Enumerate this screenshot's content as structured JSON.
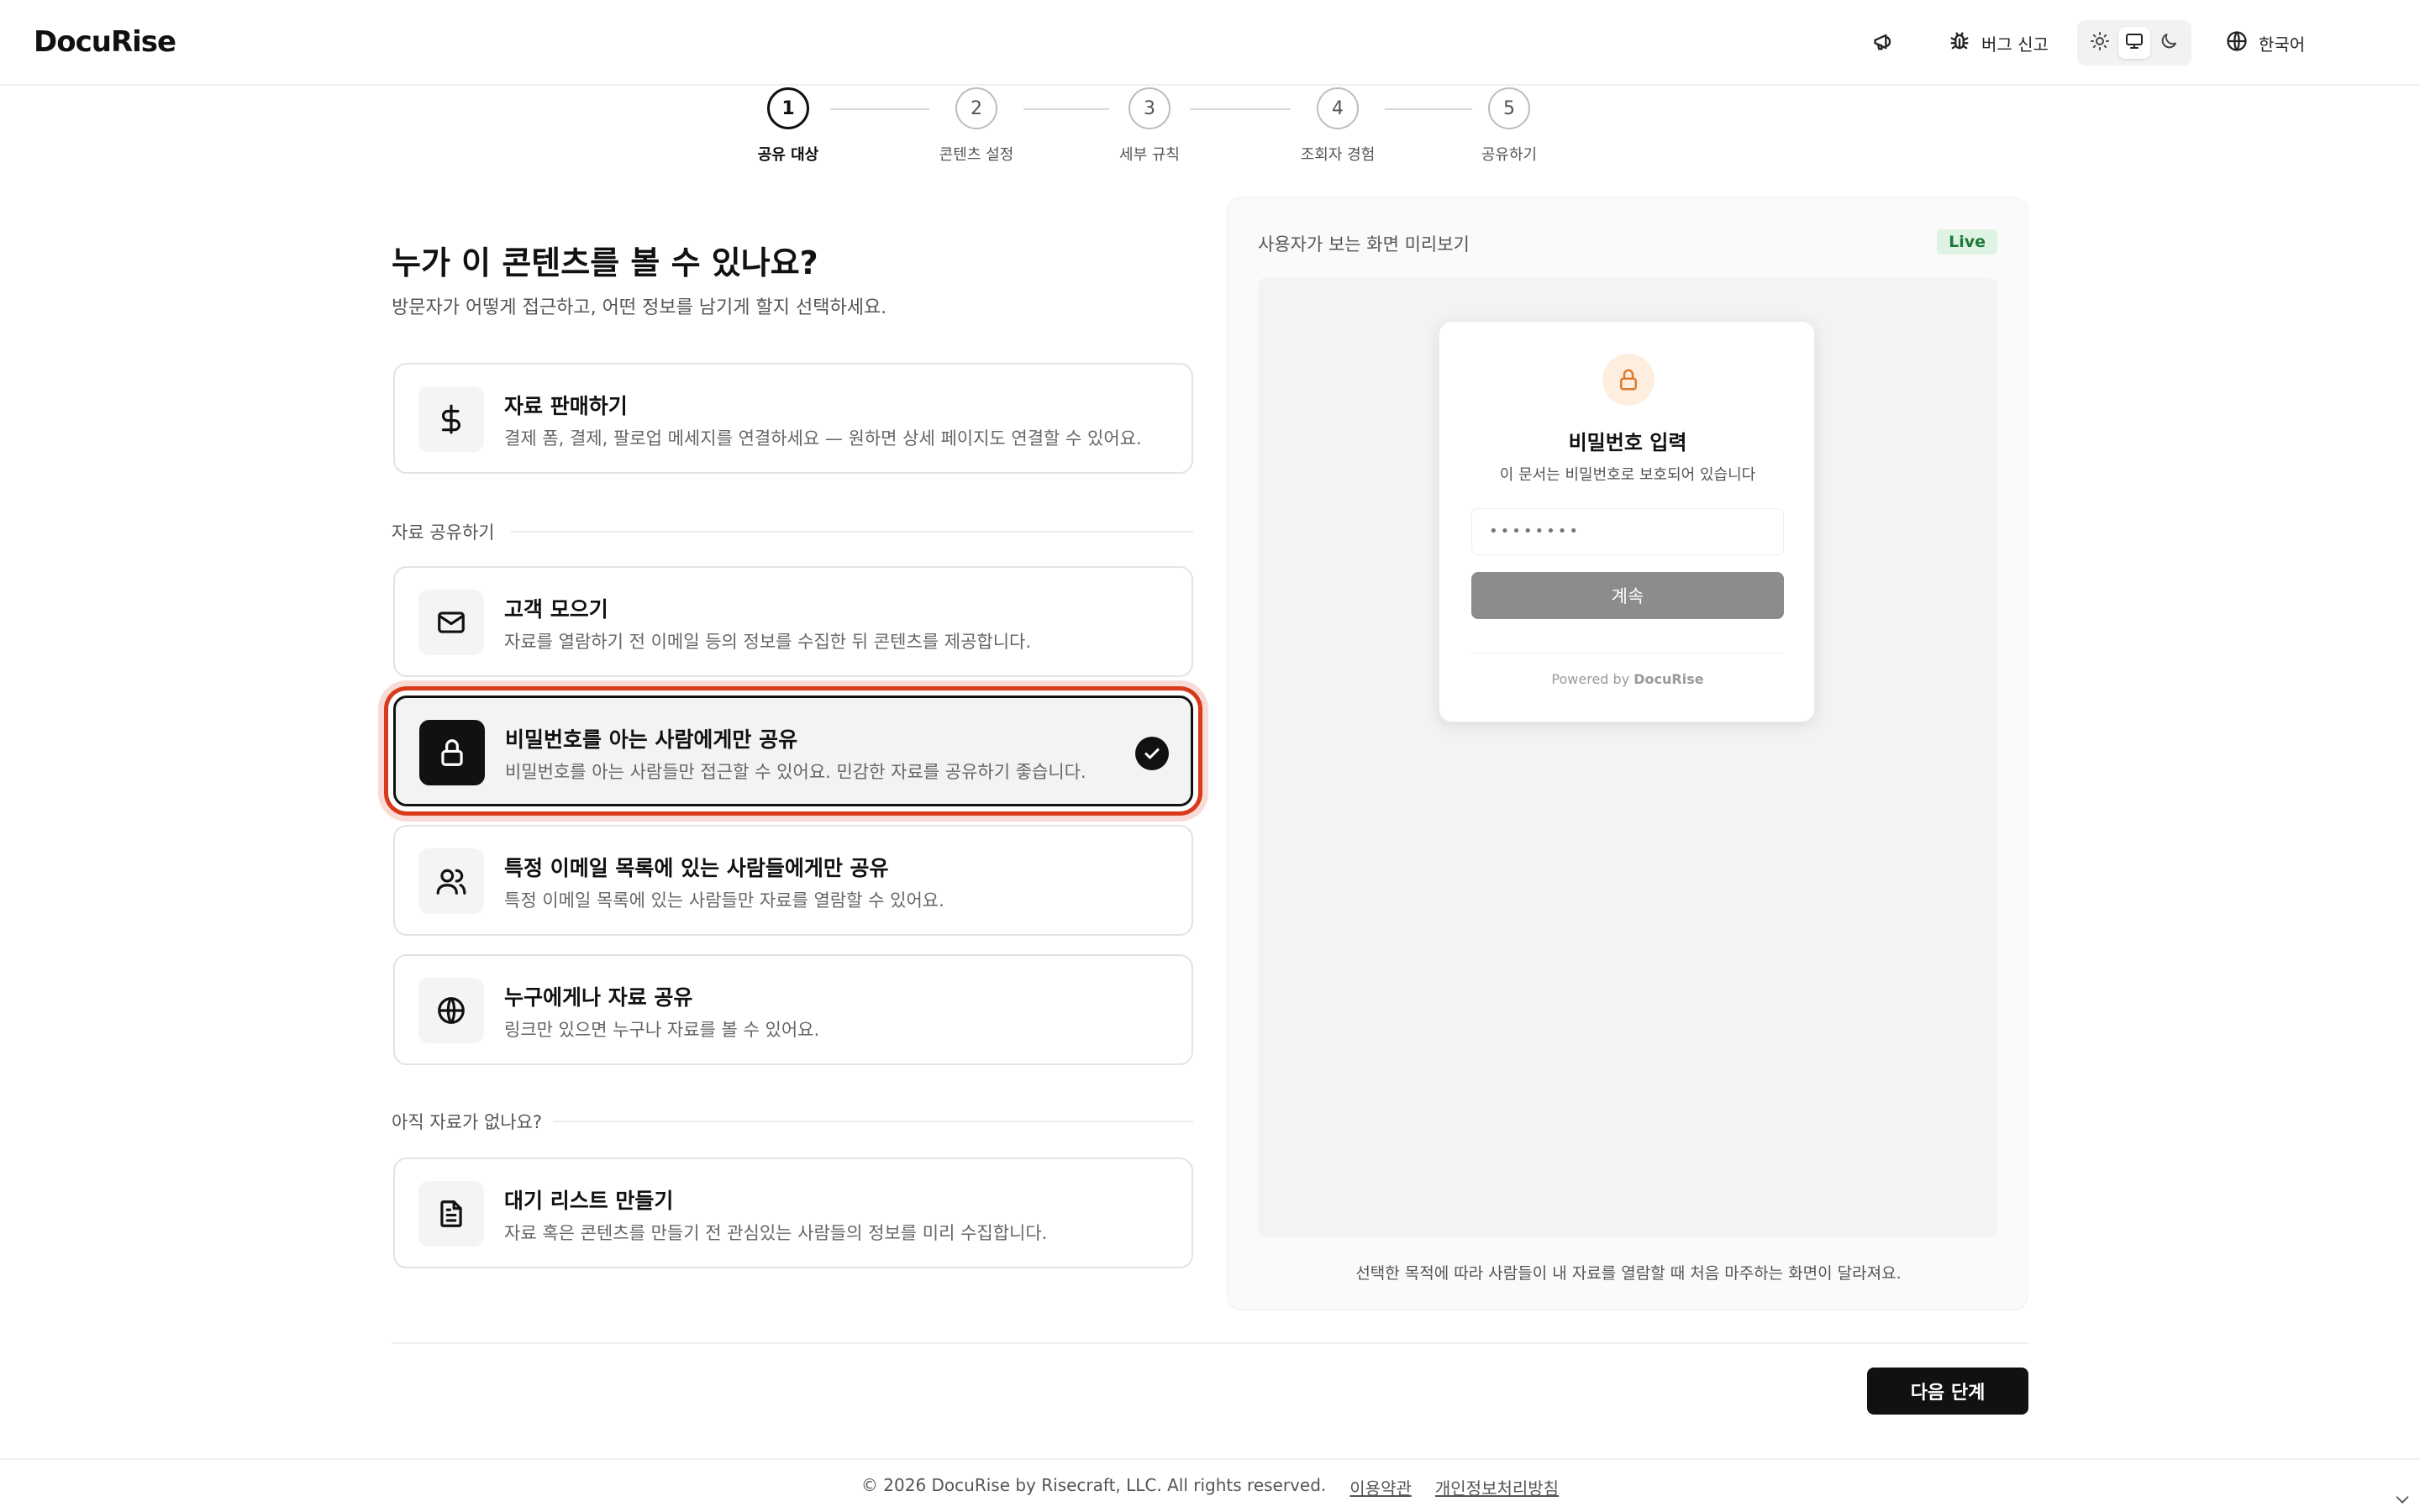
{
  "header": {
    "logo": "DocuRise",
    "bug_report_label": "버그 신고",
    "language_label": "한국어"
  },
  "stepper": {
    "steps": [
      {
        "number": "1",
        "label": "공유 대상"
      },
      {
        "number": "2",
        "label": "콘텐츠 설정"
      },
      {
        "number": "3",
        "label": "세부 규칙"
      },
      {
        "number": "4",
        "label": "조회자 경험"
      },
      {
        "number": "5",
        "label": "공유하기"
      }
    ],
    "active_step": 1
  },
  "main": {
    "title": "누가 이 콘텐츠를 볼 수 있나요?",
    "subtitle": "방문자가 어떻게 접근하고, 어떤 정보를 남기게 할지 선택하세요.",
    "sell_option": {
      "icon": "dollar-icon",
      "title": "자료 판매하기",
      "description": "결제 폼, 결제, 팔로업 메세지를 연결하세요 — 원하면 상세 페이지도 연결할 수 있어요."
    },
    "share_section_label": "자료 공유하기",
    "share_options": [
      {
        "icon": "mail-icon",
        "title": "고객 모으기",
        "description": "자료를 열람하기 전 이메일 등의 정보를 수집한 뒤 콘텐츠를 제공합니다.",
        "selected": false
      },
      {
        "icon": "lock-icon",
        "title": "비밀번호를 아는 사람에게만 공유",
        "description": "비밀번호를 아는 사람들만 접근할 수 있어요. 민감한 자료를 공유하기 좋습니다.",
        "selected": true
      },
      {
        "icon": "users-icon",
        "title": "특정 이메일 목록에 있는 사람들에게만 공유",
        "description": "특정 이메일 목록에 있는 사람들만 자료를 열람할 수 있어요.",
        "selected": false
      },
      {
        "icon": "globe-icon",
        "title": "누구에게나 자료 공유",
        "description": "링크만 있으면 누구나 자료를 볼 수 있어요.",
        "selected": false
      }
    ],
    "no_content_section_label": "아직 자료가 없나요?",
    "waitlist_option": {
      "icon": "document-icon",
      "title": "대기 리스트 만들기",
      "description": "자료 혹은 콘텐츠를 만들기 전 관심있는 사람들의 정보를 미리 수집합니다."
    }
  },
  "preview": {
    "title": "사용자가 보는 화면 미리보기",
    "badge": "Live",
    "card": {
      "title": "비밀번호 입력",
      "subtitle": "이 문서는 비밀번호로 보호되어 있습니다",
      "password_value": "••••••••",
      "button_label": "계속",
      "powered_prefix": "Powered by",
      "powered_brand": "DocuRise"
    },
    "footnote": "선택한 목적에 따라 사람들이 내 자료를 열람할 때 처음 마주하는 화면이 달라져요."
  },
  "actions": {
    "next_label": "다음 단계"
  },
  "footer": {
    "copyright": "© 2026 DocuRise by Risecraft, LLC. All rights reserved.",
    "terms": "이용약관",
    "privacy": "개인정보처리방침"
  },
  "colors": {
    "accent": "#111111",
    "selection_ring": "#d93a1a",
    "live_badge_bg": "#dff3e4",
    "live_badge_text": "#1f7a3a",
    "lock_accent": "#e07b2a"
  }
}
